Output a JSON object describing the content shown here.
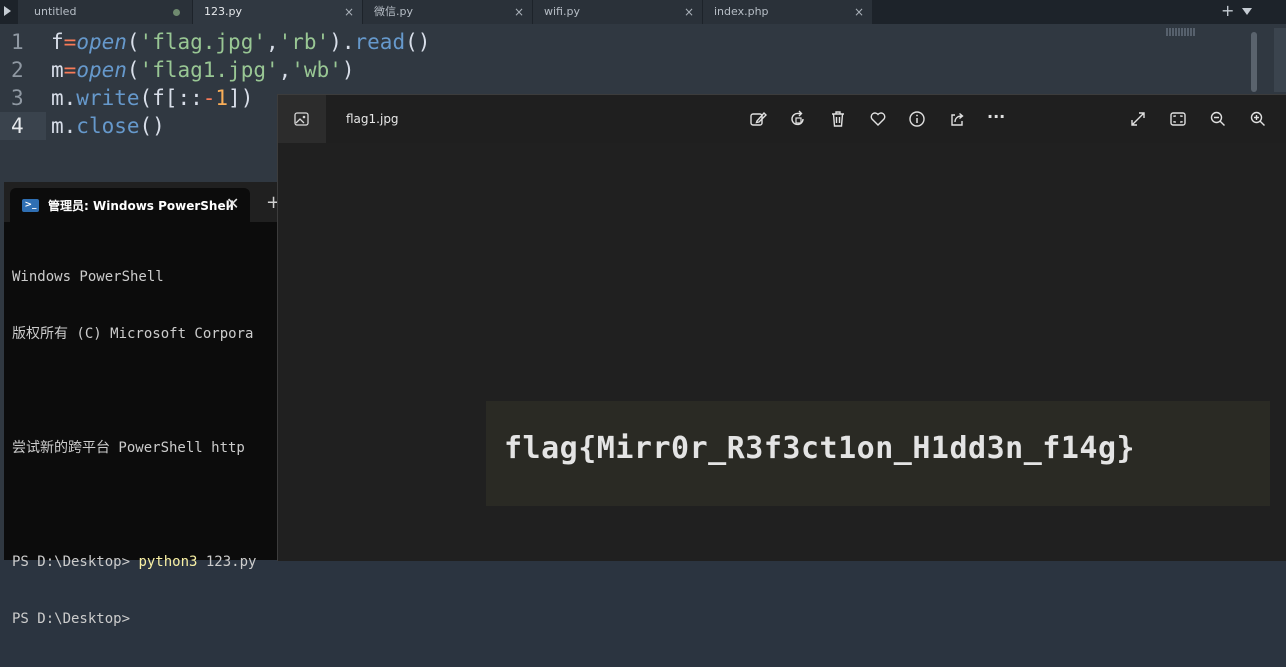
{
  "editor": {
    "tabs": [
      {
        "label": "untitled",
        "state": "dot"
      },
      {
        "label": "123.py",
        "state": "close"
      },
      {
        "label": "微信.py",
        "state": "close"
      },
      {
        "label": "wifi.py",
        "state": "close"
      },
      {
        "label": "index.php",
        "state": "close"
      }
    ],
    "tab_close_glyph": "×",
    "new_tab_glyph": "+",
    "lines": [
      {
        "num": "1"
      },
      {
        "num": "2"
      },
      {
        "num": "3"
      },
      {
        "num": "4"
      }
    ],
    "code": {
      "l1": {
        "a": "f",
        "eq": "=",
        "fn": "open",
        "p1": "(",
        "s1": "'flag.jpg'",
        "c": ",",
        "s2": "'rb'",
        "p2": ").",
        "m": "read",
        "p3": "()"
      },
      "l2": {
        "a": "m",
        "eq": "=",
        "fn": "open",
        "p1": "(",
        "s1": "'flag1.jpg'",
        "c": ",",
        "s2": "'wb'",
        "p2": ")"
      },
      "l3": {
        "a": "m.",
        "m": "write",
        "p1": "(f[::",
        "op": "-",
        "n": "1",
        "p2": "])"
      },
      "l4": {
        "a": "m.",
        "m": "close",
        "p1": "()"
      }
    },
    "colors": {
      "background": "#303841",
      "string": "#99c794",
      "function": "#6699cc",
      "operator": "#f97b58",
      "number": "#f9ae58"
    }
  },
  "terminal": {
    "tab_label": "管理员: Windows PowerShell",
    "icon_glyph": ">_",
    "close_glyph": "✕",
    "plus_glyph": "+",
    "lines": {
      "l1": "Windows PowerShell",
      "l2": "版权所有 (C) Microsoft Corpora",
      "l3": "尝试新的跨平台 PowerShell http",
      "l4_prompt": "PS D:\\Desktop> ",
      "l4_cmd": "python3",
      "l4_arg": " 123.py",
      "l5": "PS D:\\Desktop>"
    }
  },
  "viewer": {
    "file_name": "flag1.jpg",
    "icons": [
      "gallery-icon",
      "edit-icon",
      "rotate-icon",
      "delete-icon",
      "favorite-icon",
      "info-icon",
      "share-icon",
      "more-icon",
      "fullscreen-icon",
      "fit-icon",
      "zoom-out-icon",
      "zoom-in-icon"
    ],
    "flag_text": "flag{Mirr0r_R3f3ct1on_H1dd3n_f14g}",
    "more_glyph": "···"
  }
}
